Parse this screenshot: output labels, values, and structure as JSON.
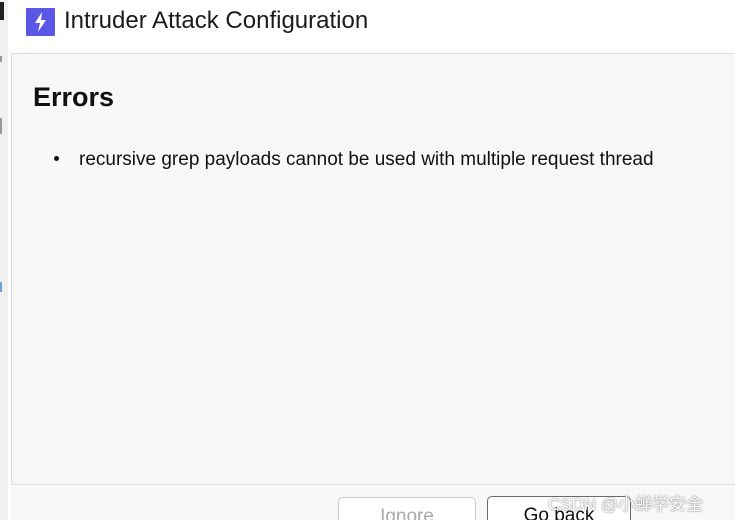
{
  "window": {
    "title": "Intruder Attack Configuration",
    "icon": "lightning-icon",
    "accent_color": "#5b57e6"
  },
  "dialog": {
    "heading": "Errors",
    "errors": [
      "recursive grep payloads cannot be used with multiple request thread"
    ]
  },
  "buttons": {
    "ignore_label": "Ignore",
    "go_back_label": "Go back"
  },
  "watermark": "CSDN @小蝉学安全"
}
